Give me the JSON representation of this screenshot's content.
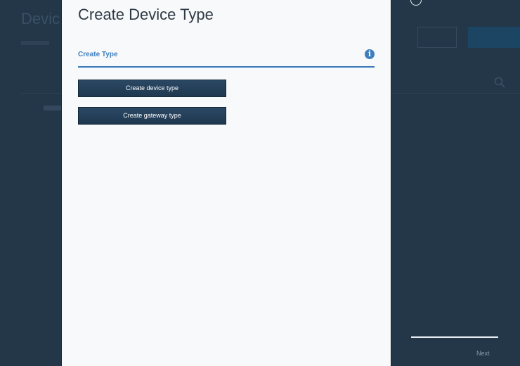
{
  "modal": {
    "title": "Create Device Type",
    "section_label": "Create Type",
    "info_icon": "info-icon",
    "buttons": {
      "device": "Create device type",
      "gateway": "Create gateway type"
    }
  },
  "wizard": {
    "next_label": "Next"
  },
  "colors": {
    "accent": "#3f7fbd",
    "button_bg": "#213a53",
    "overlay": "#233748",
    "modal_bg": "#f8f9fb"
  }
}
